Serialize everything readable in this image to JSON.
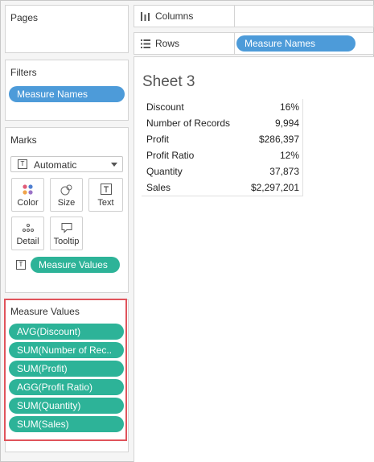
{
  "pages": {
    "title": "Pages"
  },
  "filters": {
    "title": "Filters",
    "pill": "Measure Names"
  },
  "marks": {
    "title": "Marks",
    "type_select": "Automatic",
    "buttons": [
      {
        "label": "Color"
      },
      {
        "label": "Size"
      },
      {
        "label": "Text"
      },
      {
        "label": "Detail"
      },
      {
        "label": "Tooltip"
      }
    ],
    "text_pill": "Measure Values"
  },
  "measure_values_card": {
    "title": "Measure Values",
    "items": [
      "AVG(Discount)",
      "SUM(Number of Rec..",
      "SUM(Profit)",
      "AGG(Profit Ratio)",
      "SUM(Quantity)",
      "SUM(Sales)"
    ]
  },
  "columns_shelf": {
    "label": "Columns"
  },
  "rows_shelf": {
    "label": "Rows",
    "pill": "Measure Names"
  },
  "sheet": {
    "title": "Sheet 3",
    "rows": [
      {
        "name": "Discount",
        "value": "16%"
      },
      {
        "name": "Number of Records",
        "value": "9,994"
      },
      {
        "name": "Profit",
        "value": "$286,397"
      },
      {
        "name": "Profit Ratio",
        "value": "12%"
      },
      {
        "name": "Quantity",
        "value": "37,873"
      },
      {
        "name": "Sales",
        "value": "$2,297,201"
      }
    ]
  },
  "colors": {
    "blue_pill": "#4d9bd9",
    "green_pill": "#2db398",
    "highlight": "#e0535b"
  }
}
